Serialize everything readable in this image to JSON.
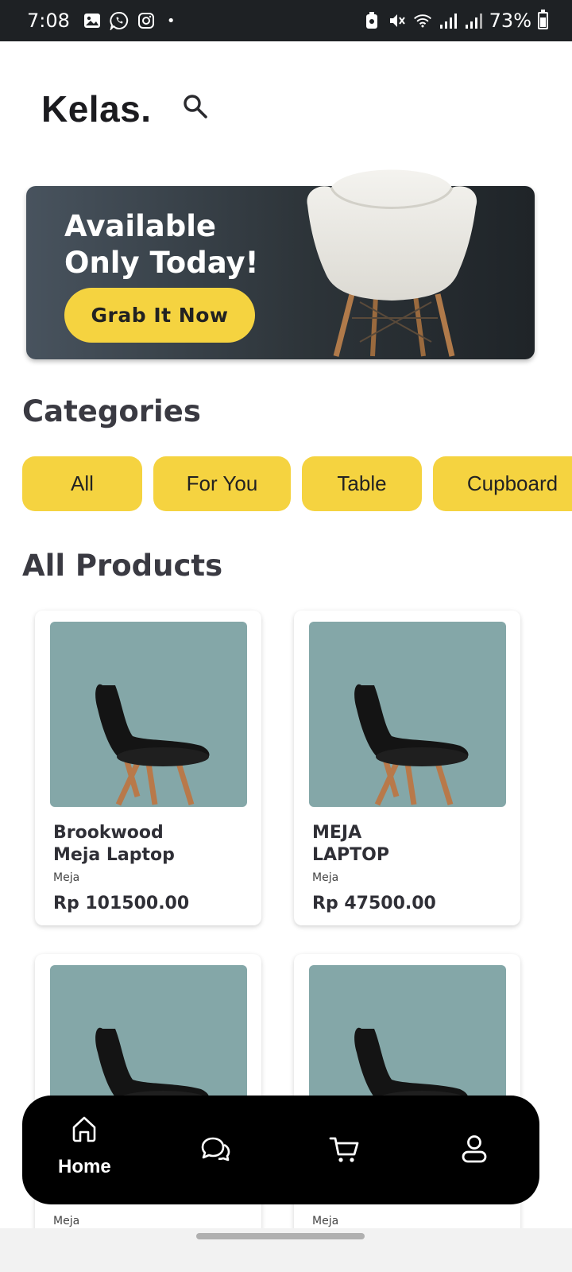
{
  "status_bar": {
    "time": "7:08",
    "battery": "73%",
    "battery_level": 0.73,
    "left_icons": [
      "gallery-icon",
      "whatsapp-icon",
      "instagram-icon"
    ],
    "right_icons": [
      "battery-saver-icon",
      "mute-icon",
      "wifi-icon",
      "signal-icon",
      "signal-icon"
    ]
  },
  "header": {
    "title": "Kelas.",
    "search_icon": "search-icon"
  },
  "banner": {
    "title_line1": "Available",
    "title_line2": "Only Today!",
    "button_label": "Grab It Now",
    "image": "white-chair"
  },
  "categories": {
    "title": "Categories",
    "items": [
      "All",
      "For You",
      "Table",
      "Cupboard"
    ]
  },
  "products": {
    "title": "All Products",
    "items": [
      {
        "name_line1": "Brookwood",
        "name_line2": "Meja Laptop",
        "category": "Meja",
        "price": "Rp 101500.00",
        "image": "black-chair"
      },
      {
        "name_line1": "MEJA",
        "name_line2": "LAPTOP",
        "category": "Meja",
        "price": "Rp 47500.00",
        "image": "black-chair"
      },
      {
        "name_line1": "",
        "name_line2": "",
        "category": "Meja",
        "price": "",
        "image": "black-chair"
      },
      {
        "name_line1": "",
        "name_line2": "",
        "category": "Meja",
        "price": "",
        "image": "black-chair"
      }
    ]
  },
  "bottom_nav": {
    "items": [
      {
        "label": "Home",
        "icon": "home-icon",
        "active": true
      },
      {
        "label": "",
        "icon": "chat-icon",
        "active": false
      },
      {
        "label": "",
        "icon": "cart-icon",
        "active": false
      },
      {
        "label": "",
        "icon": "profile-icon",
        "active": false
      }
    ]
  },
  "colors": {
    "accent": "#f5d340",
    "banner_bg": "#2d3439",
    "product_bg": "#84a7a8",
    "nav_bg": "#000000"
  }
}
